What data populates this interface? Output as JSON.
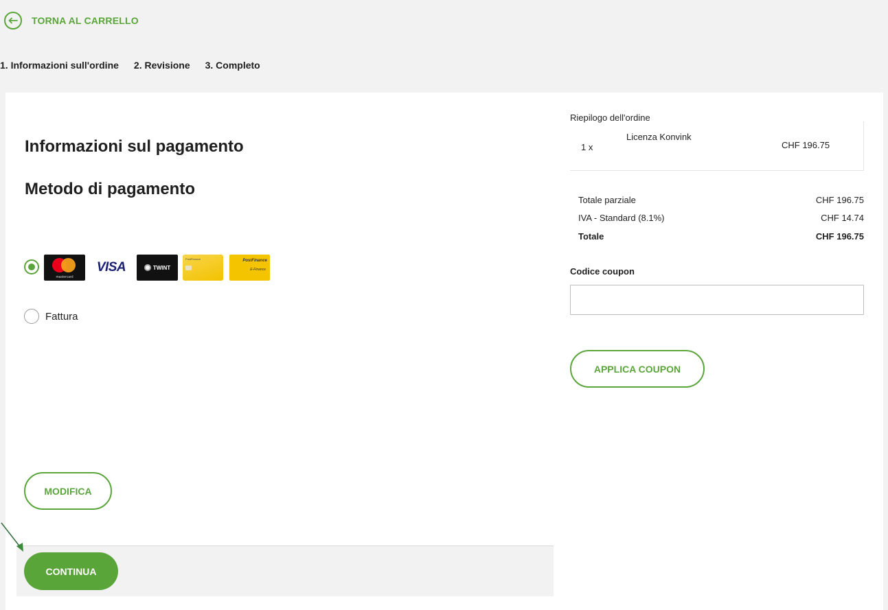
{
  "colors": {
    "accent": "#5aa53a",
    "background_grey": "#f2f2f2",
    "text": "#1e1e1e"
  },
  "nav": {
    "back_label": "TORNA AL CARRELLO",
    "back_icon": "arrow-left-circle-icon"
  },
  "steps": [
    {
      "label": "1. Informazioni sull'ordine"
    },
    {
      "label": "2. Revisione"
    },
    {
      "label": "3. Completo"
    }
  ],
  "payment": {
    "title": "Informazioni sul pagamento",
    "method_title": "Metodo di pagamento",
    "options": [
      {
        "id": "card",
        "selected": true,
        "brands": [
          "Mastercard",
          "VISA",
          "TWINT",
          "PostFinance Card",
          "PostFinance E-Finance"
        ]
      },
      {
        "id": "invoice",
        "selected": false,
        "label": "Fattura"
      }
    ],
    "logo_text": {
      "mastercard": "mastercard",
      "visa": "VISA",
      "twint": "TWINT",
      "postfinance_card": "PostFinance",
      "postfinance_efinance_brand": "PostFinance",
      "postfinance_efinance_sub": "E-Finance"
    }
  },
  "buttons": {
    "modifica": "MODIFICA",
    "continua": "CONTINUA",
    "apply_coupon": "APPLICA COUPON"
  },
  "summary": {
    "title": "Riepilogo dell'ordine",
    "items": [
      {
        "qty": "1 x",
        "name": "Licenza Konvink",
        "price": "CHF 196.75"
      }
    ],
    "subtotal_label": "Totale parziale",
    "subtotal_value": "CHF 196.75",
    "vat_label": "IVA - Standard (8.1%)",
    "vat_value": "CHF 14.74",
    "total_label": "Totale",
    "total_value": "CHF 196.75"
  },
  "coupon": {
    "label": "Codice coupon",
    "value": "",
    "placeholder": ""
  }
}
